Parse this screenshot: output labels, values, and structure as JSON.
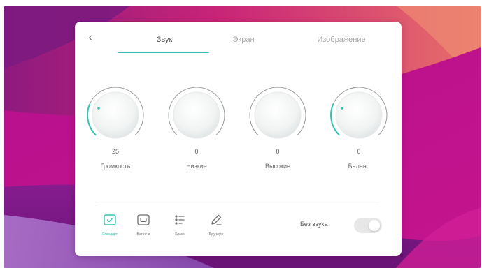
{
  "panel": {
    "back_glyph": "‹",
    "tabs": [
      {
        "label": "Звук",
        "active": true
      },
      {
        "label": "Экран",
        "active": false
      },
      {
        "label": "Изображение",
        "active": false
      }
    ]
  },
  "knobs": [
    {
      "name": "volume",
      "label": "Громкость",
      "value": "25",
      "level": 0.25
    },
    {
      "name": "bass",
      "label": "Низкие",
      "value": "0",
      "level": 0
    },
    {
      "name": "treble",
      "label": "Высокие",
      "value": "0",
      "level": 0
    },
    {
      "name": "balance",
      "label": "Баланс",
      "value": "0",
      "level": 0.25
    }
  ],
  "modes": [
    {
      "name": "standard",
      "label": "Стандарт",
      "icon": "standard-mode-icon",
      "active": true
    },
    {
      "name": "meeting",
      "label": "Встреча",
      "icon": "meeting-mode-icon",
      "active": false
    },
    {
      "name": "class",
      "label": "Класс",
      "icon": "class-mode-icon",
      "active": false
    },
    {
      "name": "custom",
      "label": "Вручную",
      "icon": "pen-icon",
      "active": false
    }
  ],
  "mute": {
    "label": "Без звука",
    "on": false
  },
  "colors": {
    "accent": "#36c2b0",
    "wallpaper_top": "#d4286e",
    "wallpaper_right": "#e06070",
    "wallpaper_magenta": "#c0108c",
    "wallpaper_purple": "#7a1888",
    "wallpaper_low_purple": "#9a60c0"
  }
}
